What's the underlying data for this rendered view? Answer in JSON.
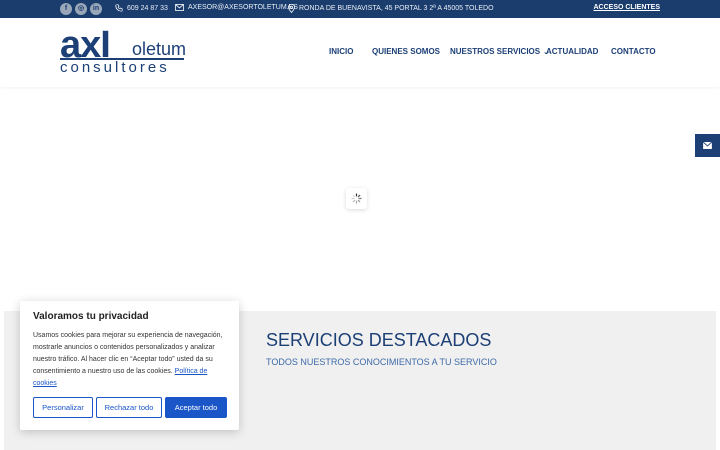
{
  "topbar": {
    "social": [
      {
        "name": "facebook",
        "glyph": "f"
      },
      {
        "name": "instagram",
        "glyph": "◎"
      },
      {
        "name": "linkedin",
        "glyph": "in"
      }
    ],
    "phone": "609 24 87 33",
    "email": "AXESOR@AXESORTOLETUM.ES",
    "address": "RONDA DE BUENAVISTA, 45 PORTAL 3 2ª A 45005 TOLEDO",
    "client_access": "ACCESO CLIENTES"
  },
  "logo": {
    "part1": "axI",
    "part2": "oletum",
    "part3": "consultores"
  },
  "nav": {
    "items": [
      "INICIO",
      "QUIENES SOMOS",
      "NUESTROS SERVICIOS",
      "ACTUALIDAD",
      "CONTACTO"
    ],
    "dropdown_glyph": "⌄"
  },
  "featured": {
    "title": "SERVICIOS DESTACADOS",
    "subtitle": "TODOS NUESTROS CONOCIMIENTOS A TU SERVICIO"
  },
  "cookie": {
    "title": "Valoramos tu privacidad",
    "text": "Usamos cookies para mejorar su experiencia de navegación, mostrarle anuncios o contenidos personalizados y analizar nuestro tráfico. Al hacer clic en “Aceptar todo” usted da su consentimiento a nuestro uso de las cookies.",
    "policy_link": "Política de cookies",
    "buttons": {
      "customize": "Personalizar",
      "reject": "Rechazar todo",
      "accept": "Aceptar todo"
    }
  },
  "colors": {
    "brand": "#1c3f76",
    "topbar": "#1a3d6e",
    "accent": "#1a56c8"
  }
}
